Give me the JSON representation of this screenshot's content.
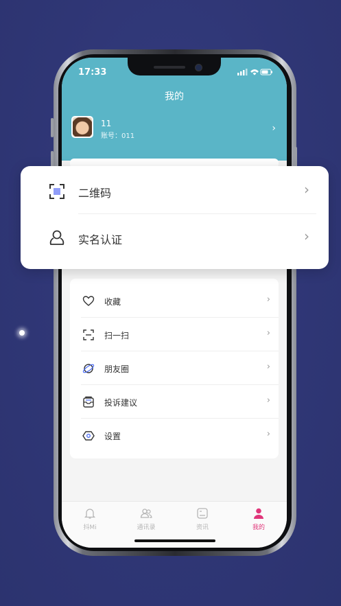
{
  "status": {
    "time": "17:33"
  },
  "header": {
    "title": "我的"
  },
  "profile": {
    "name": "11",
    "account": "账号：011"
  },
  "popup_items": [
    {
      "label": "二维码",
      "icon": "qr-scan-icon"
    },
    {
      "label": "实名认证",
      "icon": "person-verify-icon"
    }
  ],
  "menu_items": [
    {
      "label": "收藏",
      "icon": "heart-icon"
    },
    {
      "label": "扫一扫",
      "icon": "scan-icon"
    },
    {
      "label": "朋友圈",
      "icon": "planet-icon"
    },
    {
      "label": "投诉建议",
      "icon": "feedback-icon"
    },
    {
      "label": "设置",
      "icon": "settings-icon"
    }
  ],
  "tabs": [
    {
      "label": "抖Mi",
      "icon": "bell-icon",
      "active": false
    },
    {
      "label": "通讯录",
      "icon": "contacts-icon",
      "active": false
    },
    {
      "label": "资讯",
      "icon": "news-icon",
      "active": false
    },
    {
      "label": "我的",
      "icon": "person-icon",
      "active": true
    }
  ],
  "colors": {
    "header": "#5ab5c7",
    "active_tab": "#e0367a",
    "background": "#2f3675"
  },
  "chevron": "›"
}
